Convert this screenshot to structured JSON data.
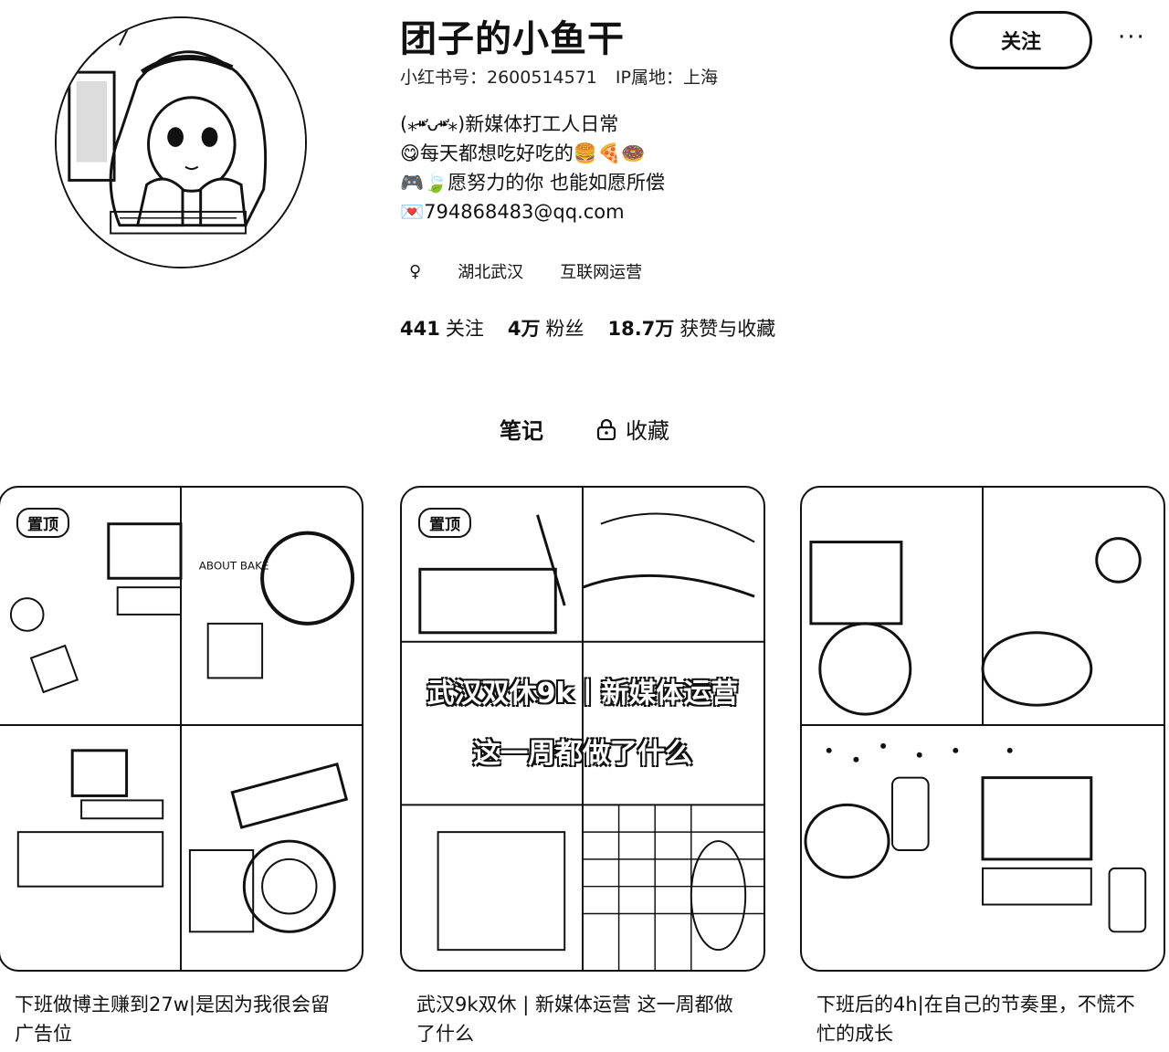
{
  "profile": {
    "name": "团子的小鱼干",
    "id_label": "小红书号：2600514571",
    "ip_label": "IP属地：上海",
    "bio": [
      "(⁎⁍̴̛ᴗ⁍̴̛⁎)新媒体打工人日常",
      "😋每天都想吃好吃的🍔🍕🍩",
      "🎮🍃愿努力的你 也能如愿所偿",
      "💌794868483@qq.com"
    ],
    "gender_symbol": "♀",
    "location": "湖北武汉",
    "industry": "互联网运营",
    "stats": {
      "following_num": "441",
      "following_label": "关注",
      "fans_num": "4万",
      "fans_label": "粉丝",
      "likes_num": "18.7万",
      "likes_label": "获赞与收藏"
    }
  },
  "actions": {
    "follow_label": "关注",
    "more_label": "···"
  },
  "tabs": {
    "notes": "笔记",
    "favorites": "收藏"
  },
  "notes": [
    {
      "pinned_label": "置顶",
      "title": "下班做博主赚到27w|是因为我很会留广告位",
      "overlay": ""
    },
    {
      "pinned_label": "置顶",
      "title": "武汉9k双休 | 新媒体运营 这一周都做了什么",
      "overlay_line1": "武汉双休9k丨新媒体运营",
      "overlay_line2": "这一周都做了什么"
    },
    {
      "title": "下班后的4h|在自己的节奏里，不慌不忙的成长"
    }
  ]
}
